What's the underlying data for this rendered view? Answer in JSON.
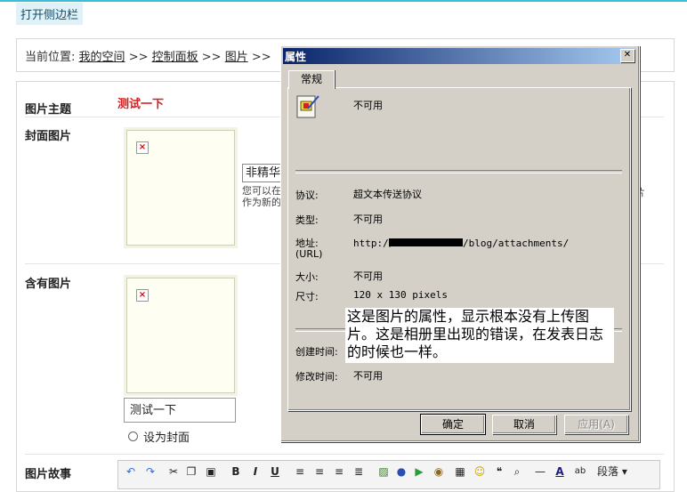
{
  "sidebar_toggle": "打开侧边栏",
  "breadcrumb": {
    "prefix": "当前位置:",
    "items": [
      "我的空间",
      "控制面板",
      "图片"
    ],
    "separator": ">>",
    "trailing_sep": ">>"
  },
  "form": {
    "title_label": "图片主题",
    "title_value": "测试一下",
    "cover_label": "封面图片",
    "contains_label": "含有图片",
    "story_label": "图片故事",
    "partial_input": "非精华",
    "partial_hint_1": "您可以在",
    "partial_hint_2": "作为新的",
    "partial_hint_right": "片",
    "caption_value": "测试一下",
    "set_cover_label": "设为封面",
    "paragraph_label": "段落"
  },
  "dialog": {
    "title": "属性",
    "close_glyph": "✕",
    "tab": "常规",
    "name_value": "不可用",
    "protocol_label": "协议:",
    "protocol_value": "超文本传送协议",
    "type_label": "类型:",
    "type_value": "不可用",
    "address_label": "地址:",
    "address_sub": "(URL)",
    "address_prefix": "http://",
    "address_suffix": "/blog/attachments/",
    "size_label": "大小:",
    "size_value": "不可用",
    "dims_label": "尺寸:",
    "dims_value": "120  x  130  pixels",
    "created_label": "创建时间:",
    "modified_label": "修改时间:",
    "modified_value": "不可用",
    "ok": "确定",
    "cancel": "取消",
    "apply": "应用(A)"
  },
  "annotation": "这是图片的属性，显示根本没有上传图片。这是相册里出现的错误，在发表日志的时候也一样。",
  "colors": {
    "accent_line": "#37c0d8",
    "title_red": "#d42020",
    "dialog_face": "#d4d0c8",
    "titlebar_start": "#0a246a",
    "titlebar_end": "#a6caf0"
  }
}
